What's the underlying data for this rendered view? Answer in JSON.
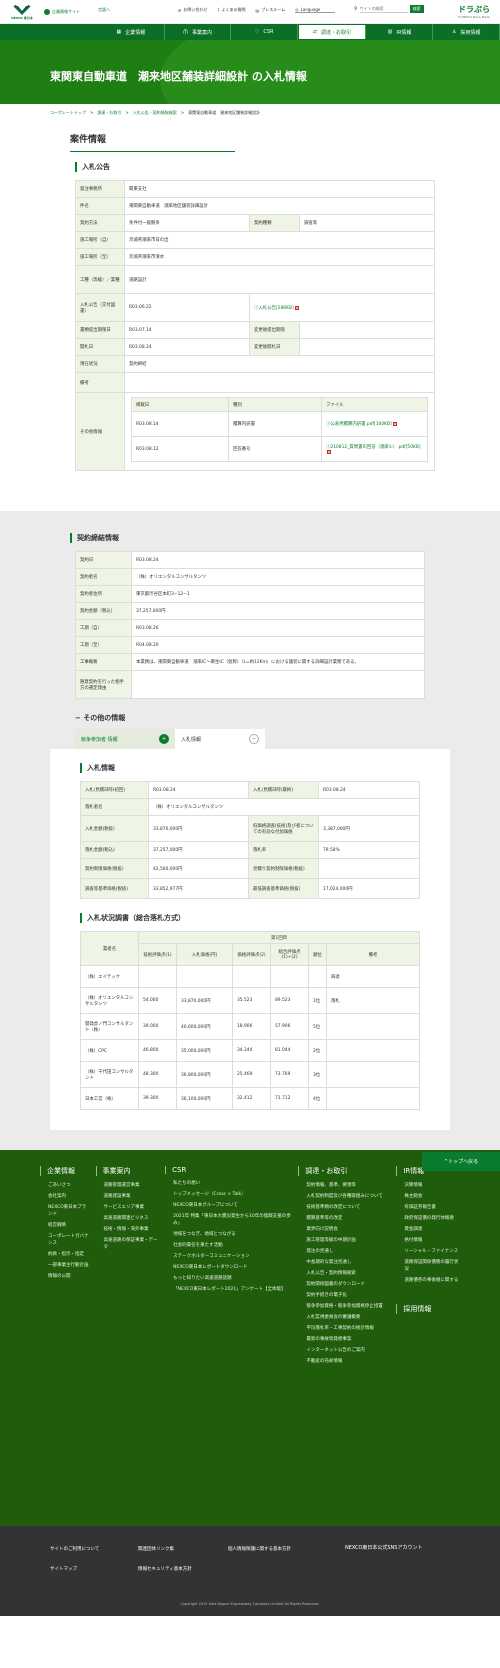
{
  "header": {
    "logo_text": "NEXCO 東日本",
    "site_label": "企業情報サイト",
    "language": "言語へ",
    "util": [
      "お問い合わせ",
      "よくある質問",
      "プレスルーム"
    ],
    "language_box": "Language",
    "search_placeholder": "サイト内検索",
    "search_button": "検索",
    "drapura": "ドラぷら",
    "drapura_sub": "E-NEXCO Drive Plaza"
  },
  "nav": [
    "企業情報",
    "事業案内",
    "CSR",
    "調達・お取引",
    "IR情報",
    "採用情報"
  ],
  "hero": {
    "title": "東関東自動車道　潮来地区舗装詳細設計 の入札情報"
  },
  "breadcrumb": [
    "コーポレートトップ",
    "調達・お取引",
    "入札公告・契約情報検索",
    "東関東自動車道　潮来地区舗装詳細設計"
  ],
  "case": {
    "title": "案件情報",
    "section": "入札公告",
    "rows": [
      {
        "k": "発注事務所",
        "v": "関東支社"
      },
      {
        "k": "件名",
        "v": "東関東自動車道　潮来地区舗装詳細設計"
      },
      {
        "k": "契約方法",
        "v": "条件付一般競争",
        "k2": "契約種類",
        "v2": "調査等"
      },
      {
        "k": "施工場所（自）",
        "v": "茨城県潮来市日の出"
      },
      {
        "k": "施工場所（至）",
        "v": "茨城県潮来市清水"
      },
      {
        "k": "工種（等級）／業種",
        "v": "道路設計"
      },
      {
        "k": "入札公告（交付図書）",
        "v": "R03.06.22",
        "link": "入札公告[286KB]"
      },
      {
        "k": "書類提出期限日",
        "v": "R03.07.14",
        "k2": "変更後提出期限",
        "v2": ""
      },
      {
        "k": "開札日",
        "v": "R03.08.24",
        "k2": "変更後開札日",
        "v2": ""
      },
      {
        "k": "現在状況",
        "v": "契約締結"
      },
      {
        "k": "備考",
        "v": ""
      }
    ],
    "other_label": "その他情報",
    "other_headers": [
      "掲載日",
      "種別",
      "ファイル"
    ],
    "other_rows": [
      {
        "date": "R03.08.14",
        "type": "積算内訳書",
        "file": "公表用積算内訳書.pdf[100KB]"
      },
      {
        "date": "R03.08.12",
        "type": "回答番号",
        "file": "210812_質問書の回答（潮来①）.pdf[50KB]"
      }
    ]
  },
  "contract": {
    "section": "契約締結情報",
    "rows": [
      {
        "k": "契約日",
        "v": "R03.08.24"
      },
      {
        "k": "契約者名",
        "v": "（株）オリエンタルコンサルタンツ"
      },
      {
        "k": "契約者住所",
        "v": "東京都渋谷区本町3−12−1"
      },
      {
        "k": "契約金額（税込）",
        "v": "37,257,000円"
      },
      {
        "k": "工期（自）",
        "v": "R03.08.26"
      },
      {
        "k": "工期（至）",
        "v": "R04.08.20"
      },
      {
        "k": "工事概要",
        "v": "本業務は、東関東自動車道　潮来IC～麻生IC（仮称）（L=約12Km）における舗装に関する詳細設計業務である。"
      },
      {
        "k": "随意契約を行った相手方の選定理由",
        "v": ""
      }
    ]
  },
  "other": {
    "title": "その他の情報",
    "tab_off": "競争参加者 情報",
    "tab_on": "入札情報",
    "tab_off_icon": "+",
    "tab_on_icon": "−"
  },
  "bidinfo": {
    "section": "入札情報",
    "rows": [
      [
        "入札/見積日時(初回)",
        "R03.08.24",
        "入札/見積日時(最終)",
        "R03.08.24"
      ],
      [
        "落札者名",
        "（株）オリエンタルコンサルタンツ",
        "",
        ""
      ],
      [
        "入札金額(税抜)",
        "33,870,000円",
        "低価格調査(技術)及び者についての有効な付加価値",
        "3,387,000円"
      ],
      [
        "落札金額(税込)",
        "37,257,000円",
        "落札率",
        "79.58%"
      ],
      [
        "契約制限価格(税抜)",
        "42,560,000円",
        "見積り契約制限価格(税抜)",
        ""
      ],
      [
        "調査等基準価格(税抜)",
        "33,852,977円",
        "最低調査基準価格(税抜)",
        "17,024,000円"
      ]
    ]
  },
  "status": {
    "section": "入札状況調書（総合落札方式）",
    "round": "第1回目",
    "col_company": "業者名",
    "cols": [
      "技術評価点(1)",
      "入札価格(円)",
      "価格評価点(2)",
      "総合評価点(1)+(2)",
      "順位",
      "備考"
    ],
    "rows": [
      [
        "（株）エイテック",
        "",
        "",
        "",
        "",
        "",
        "辞退"
      ],
      [
        "（株）オリエンタルコンサルタンツ",
        "54.000",
        "33,870,000円",
        "35.523",
        "89.523",
        "1位",
        "落札"
      ],
      [
        "開発虎ノ門コンサルタント（株）",
        "39.000",
        "40,600,000円",
        "18.906",
        "57.906",
        "5位",
        ""
      ],
      [
        "（株）CPC",
        "46.800",
        "35,000,000円",
        "34.244",
        "81.044",
        "2位",
        ""
      ],
      [
        "（株）千代田コンサルタント",
        "48.300",
        "36,800,000円",
        "25.469",
        "73.769",
        "3位",
        ""
      ],
      [
        "日本工営（株）",
        "39.300",
        "36,100,000円",
        "32.412",
        "71.712",
        "4位",
        ""
      ]
    ]
  },
  "totop": "トップへ戻る",
  "footer": {
    "cols": [
      {
        "t": "企業情報",
        "items": [
          "ごあいさつ",
          "会社案内",
          "NEXCO東日本ブランド",
          "経営戦略",
          "コーポレートガバナンス",
          "約款・指示・指定",
          "一部事業主行動計画",
          "情報の公開"
        ]
      },
      {
        "t": "事業案内",
        "items": [
          "道路管理運営事業",
          "道路建設事業",
          "サービスエリア事業",
          "高速道路関連ビジネス",
          "技術・情報・海外事業",
          "高速道路の保証事業・データ"
        ]
      },
      {
        "t": "CSR",
        "items": [
          "私たちの想い",
          "トップメッセージ（Cross × Talk）",
          "NEXCO東日本グループについて",
          "2021年 特集「東日本大震災発生から10年の復興支援の歩み」",
          "地域をつなぎ、地域とつながる",
          "社会的責任を果たす活動",
          "ステークホルダーコミュニケーション",
          "NEXCO東日本レポートダウンロード",
          "もっと知りたい高速道路話題",
          "「NEXCO東日本レポート2021」アンケート【全体版】"
        ]
      },
      {
        "t": "調達・お取引",
        "items": [
          "契約情報、基準、要領等",
          "入札契約制度及び各種取組みについて",
          "技術基準類の改定について",
          "積算基準等の改定",
          "業界向け説明会",
          "施工管理等級の中期計画",
          "発注の見通し",
          "中長期的な発注見通し",
          "入札公告・契約情報検索",
          "契約関係図書のダウンロード",
          "契約手続きの電子化",
          "競争参加資格・競争参加資格停止措置",
          "入札監視委員会の審議概要",
          "平均落札率・工事契約の統計情報",
          "最新の事故等発想事案",
          "インターネット公告のご案内",
          "不動産の売却情報"
        ]
      },
      {
        "t": "IR情報",
        "items": [
          "決算情報",
          "株主総会",
          "有価証券報告書",
          "政府保証債の発行体概要",
          "資金調達",
          "格付情報",
          "ソーシャル・ファイナンス",
          "道路保証関係債務の履行状況",
          "道路債券の事後継に関する"
        ],
        "t2": "採用情報"
      }
    ]
  },
  "bottom": {
    "links": [
      "サイトのご利用について",
      "関連団体リンク集",
      "個人情報保護に関する基本方針",
      "情報セキュリティ基本方針",
      "サイトマップ"
    ],
    "sns": "NEXCO東日本公式SNSアカウント",
    "copyright": "Copyright 2015 East Nippon Expressway Company Limited All Rights Reserved."
  }
}
